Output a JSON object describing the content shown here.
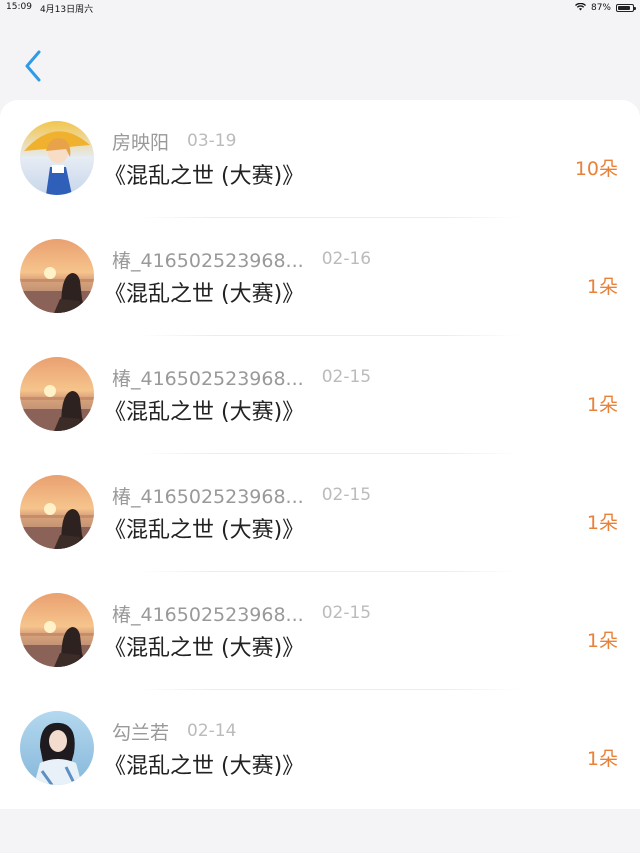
{
  "status_bar": {
    "time": "15:09",
    "date": "4月13日周六",
    "battery": "87%",
    "battery_level": 0.87
  },
  "nav": {
    "back_icon": "chevron-left-icon",
    "accent": "#2f9be8"
  },
  "list": [
    {
      "name": "房映阳",
      "date": "03-19",
      "title": "《混乱之世 (大赛)》",
      "amount": "10朵",
      "avatar": "anime"
    },
    {
      "name": "椿_416502523968...",
      "date": "02-16",
      "title": "《混乱之世 (大赛)》",
      "amount": "1朵",
      "avatar": "sunset"
    },
    {
      "name": "椿_416502523968...",
      "date": "02-15",
      "title": "《混乱之世 (大赛)》",
      "amount": "1朵",
      "avatar": "sunset"
    },
    {
      "name": "椿_416502523968...",
      "date": "02-15",
      "title": "《混乱之世 (大赛)》",
      "amount": "1朵",
      "avatar": "sunset"
    },
    {
      "name": "椿_416502523968...",
      "date": "02-15",
      "title": "《混乱之世 (大赛)》",
      "amount": "1朵",
      "avatar": "sunset"
    },
    {
      "name": "勾兰若",
      "date": "02-14",
      "title": "《混乱之世 (大赛)》",
      "amount": "1朵",
      "avatar": "girl"
    }
  ],
  "colors": {
    "amount": "#e8823a",
    "name": "#999999",
    "date": "#bbbbbb"
  }
}
